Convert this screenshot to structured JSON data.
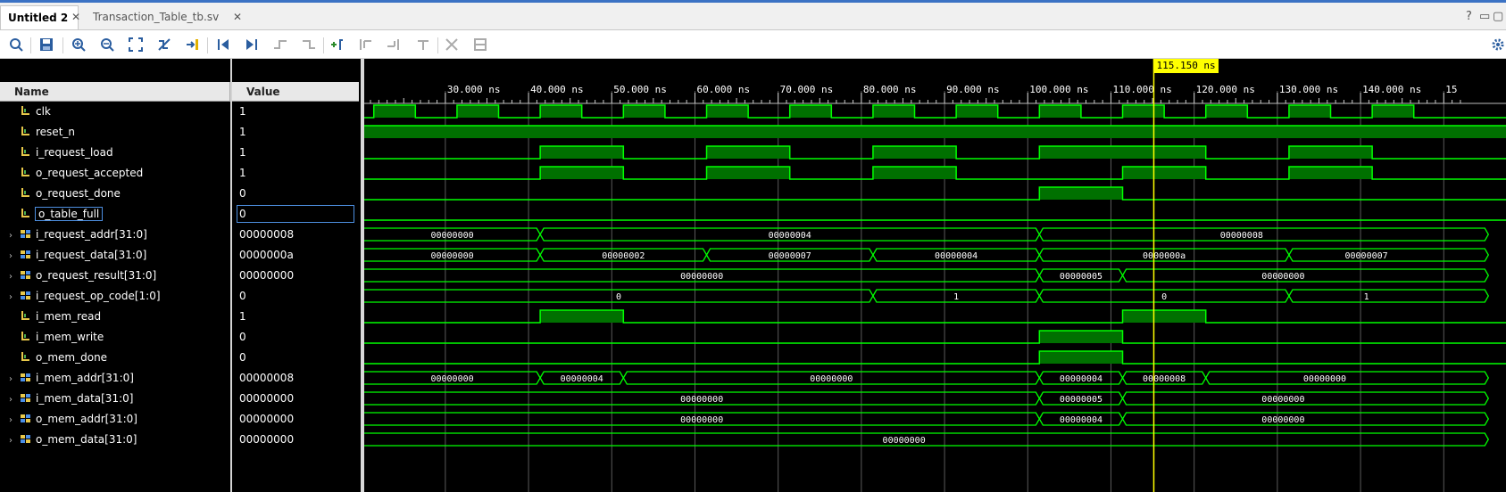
{
  "tabs": [
    {
      "label": "Untitled 2",
      "active": true
    },
    {
      "label": "Transaction_Table_tb.sv",
      "active": false
    }
  ],
  "window_controls": {
    "help": "?",
    "restore": "□"
  },
  "toolbar": {
    "icons": [
      "search-icon",
      "save-icon",
      "zoom-in-icon",
      "zoom-out-icon",
      "zoom-fit-icon",
      "wave-tool-icon",
      "go-to-cursor-icon",
      "go-to-time-zero-icon",
      "go-to-last-time-icon",
      "previous-transition-icon",
      "next-transition-icon",
      "add-marker-icon",
      "previous-marker-icon",
      "next-marker-icon",
      "swap-cursors-icon",
      "cut-icon",
      "snap-icon"
    ]
  },
  "headers": {
    "name": "Name",
    "value": "Value"
  },
  "signals": [
    {
      "name": "clk",
      "value": "1",
      "kind": "bit"
    },
    {
      "name": "reset_n",
      "value": "1",
      "kind": "bit"
    },
    {
      "name": "i_request_load",
      "value": "1",
      "kind": "bit"
    },
    {
      "name": "o_request_accepted",
      "value": "1",
      "kind": "bit"
    },
    {
      "name": "o_request_done",
      "value": "0",
      "kind": "bit"
    },
    {
      "name": "o_table_full",
      "value": "0",
      "kind": "bit"
    },
    {
      "name": "i_request_addr[31:0]",
      "value": "00000008",
      "kind": "bus"
    },
    {
      "name": "i_request_data[31:0]",
      "value": "0000000a",
      "kind": "bus"
    },
    {
      "name": "o_request_result[31:0]",
      "value": "00000000",
      "kind": "bus"
    },
    {
      "name": "i_request_op_code[1:0]",
      "value": "0",
      "kind": "bus"
    },
    {
      "name": "i_mem_read",
      "value": "1",
      "kind": "bit"
    },
    {
      "name": "i_mem_write",
      "value": "0",
      "kind": "bit"
    },
    {
      "name": "o_mem_done",
      "value": "0",
      "kind": "bit"
    },
    {
      "name": "i_mem_addr[31:0]",
      "value": "00000008",
      "kind": "bus"
    },
    {
      "name": "i_mem_data[31:0]",
      "value": "00000000",
      "kind": "bus"
    },
    {
      "name": "o_mem_addr[31:0]",
      "value": "00000000",
      "kind": "bus"
    },
    {
      "name": "o_mem_data[31:0]",
      "value": "00000000",
      "kind": "bus"
    }
  ],
  "timeline": {
    "tick_labels": [
      "30.000 ns",
      "40.000 ns",
      "50.000 ns",
      "60.000 ns",
      "70.000 ns",
      "80.000 ns",
      "90.000 ns",
      "100.000 ns",
      "110.000 ns",
      "120.000 ns",
      "130.000 ns",
      "140.000 ns",
      "15"
    ],
    "tick_times": [
      30,
      40,
      50,
      60,
      70,
      80,
      90,
      100,
      110,
      120,
      130,
      140,
      150
    ],
    "cursor_label": "115.150 ns",
    "cursor_time": 115.15
  },
  "waves": {
    "clk": {
      "type": "bit",
      "initial": 0,
      "transitions": [
        [
          21.4,
          1
        ],
        [
          26.4,
          0
        ],
        [
          31.4,
          1
        ],
        [
          36.4,
          0
        ],
        [
          41.4,
          1
        ],
        [
          46.4,
          0
        ],
        [
          51.4,
          1
        ],
        [
          56.4,
          0
        ],
        [
          61.4,
          1
        ],
        [
          66.4,
          0
        ],
        [
          71.4,
          1
        ],
        [
          76.4,
          0
        ],
        [
          81.4,
          1
        ],
        [
          86.4,
          0
        ],
        [
          91.4,
          1
        ],
        [
          96.4,
          0
        ],
        [
          101.4,
          1
        ],
        [
          106.4,
          0
        ],
        [
          111.4,
          1
        ],
        [
          116.4,
          0
        ],
        [
          121.4,
          1
        ],
        [
          126.4,
          0
        ],
        [
          131.4,
          1
        ],
        [
          136.4,
          0
        ],
        [
          141.4,
          1
        ],
        [
          146.4,
          0
        ]
      ]
    },
    "reset_n": {
      "type": "bit",
      "initial": 1,
      "transitions": []
    },
    "i_request_load": {
      "type": "bit",
      "initial": 0,
      "transitions": [
        [
          41.4,
          1
        ],
        [
          51.4,
          0
        ],
        [
          61.4,
          1
        ],
        [
          71.4,
          0
        ],
        [
          81.4,
          1
        ],
        [
          91.4,
          0
        ],
        [
          101.4,
          1
        ],
        [
          121.4,
          0
        ],
        [
          131.4,
          1
        ],
        [
          141.4,
          0
        ]
      ]
    },
    "o_request_accepted": {
      "type": "bit",
      "initial": 0,
      "transitions": [
        [
          41.4,
          1
        ],
        [
          51.4,
          0
        ],
        [
          61.4,
          1
        ],
        [
          71.4,
          0
        ],
        [
          81.4,
          1
        ],
        [
          91.4,
          0
        ],
        [
          111.4,
          1
        ],
        [
          121.4,
          0
        ],
        [
          131.4,
          1
        ],
        [
          141.4,
          0
        ]
      ]
    },
    "o_request_done": {
      "type": "bit",
      "initial": 0,
      "transitions": [
        [
          101.4,
          1
        ],
        [
          111.4,
          0
        ]
      ]
    },
    "o_table_full": {
      "type": "bit",
      "initial": 0,
      "transitions": []
    },
    "i_request_addr": {
      "type": "bus",
      "segments": [
        [
          20,
          41.4,
          "00000000"
        ],
        [
          41.4,
          101.4,
          "00000004"
        ],
        [
          101.4,
          150,
          "00000008"
        ]
      ]
    },
    "i_request_data": {
      "type": "bus",
      "segments": [
        [
          20,
          41.4,
          "00000000"
        ],
        [
          41.4,
          61.4,
          "00000002"
        ],
        [
          61.4,
          81.4,
          "00000007"
        ],
        [
          81.4,
          101.4,
          "00000004"
        ],
        [
          101.4,
          131.4,
          "0000000a"
        ],
        [
          131.4,
          150,
          "00000007"
        ]
      ]
    },
    "o_request_result": {
      "type": "bus",
      "segments": [
        [
          20,
          101.4,
          "00000000"
        ],
        [
          101.4,
          111.4,
          "00000005"
        ],
        [
          111.4,
          150,
          "00000000"
        ]
      ]
    },
    "i_request_op_code": {
      "type": "bus",
      "segments": [
        [
          20,
          81.4,
          "0"
        ],
        [
          81.4,
          101.4,
          "1"
        ],
        [
          101.4,
          131.4,
          "0"
        ],
        [
          131.4,
          150,
          "1"
        ]
      ]
    },
    "i_mem_read": {
      "type": "bit",
      "initial": 0,
      "transitions": [
        [
          41.4,
          1
        ],
        [
          51.4,
          0
        ],
        [
          111.4,
          1
        ],
        [
          121.4,
          0
        ]
      ]
    },
    "i_mem_write": {
      "type": "bit",
      "initial": 0,
      "transitions": [
        [
          101.4,
          1
        ],
        [
          111.4,
          0
        ]
      ]
    },
    "o_mem_done": {
      "type": "bit",
      "initial": 0,
      "transitions": [
        [
          101.4,
          1
        ],
        [
          111.4,
          0
        ]
      ]
    },
    "i_mem_addr": {
      "type": "bus",
      "segments": [
        [
          20,
          41.4,
          "00000000"
        ],
        [
          41.4,
          51.4,
          "00000004"
        ],
        [
          51.4,
          101.4,
          "00000000"
        ],
        [
          101.4,
          111.4,
          "00000004"
        ],
        [
          111.4,
          121.4,
          "00000008"
        ],
        [
          121.4,
          150,
          "00000000"
        ]
      ]
    },
    "i_mem_data": {
      "type": "bus",
      "segments": [
        [
          20,
          101.4,
          "00000000"
        ],
        [
          101.4,
          111.4,
          "00000005"
        ],
        [
          111.4,
          150,
          "00000000"
        ]
      ]
    },
    "o_mem_addr": {
      "type": "bus",
      "segments": [
        [
          20,
          101.4,
          "00000000"
        ],
        [
          101.4,
          111.4,
          "00000004"
        ],
        [
          111.4,
          150,
          "00000000"
        ]
      ]
    },
    "o_mem_data": {
      "type": "bus",
      "segments": [
        [
          20,
          150,
          "00000000"
        ]
      ]
    }
  },
  "colors": {
    "wave": "#00ff00",
    "wave_fill": "#007000",
    "cursor": "#ffff00",
    "grid": "#5a5a5a",
    "background": "#000000"
  }
}
